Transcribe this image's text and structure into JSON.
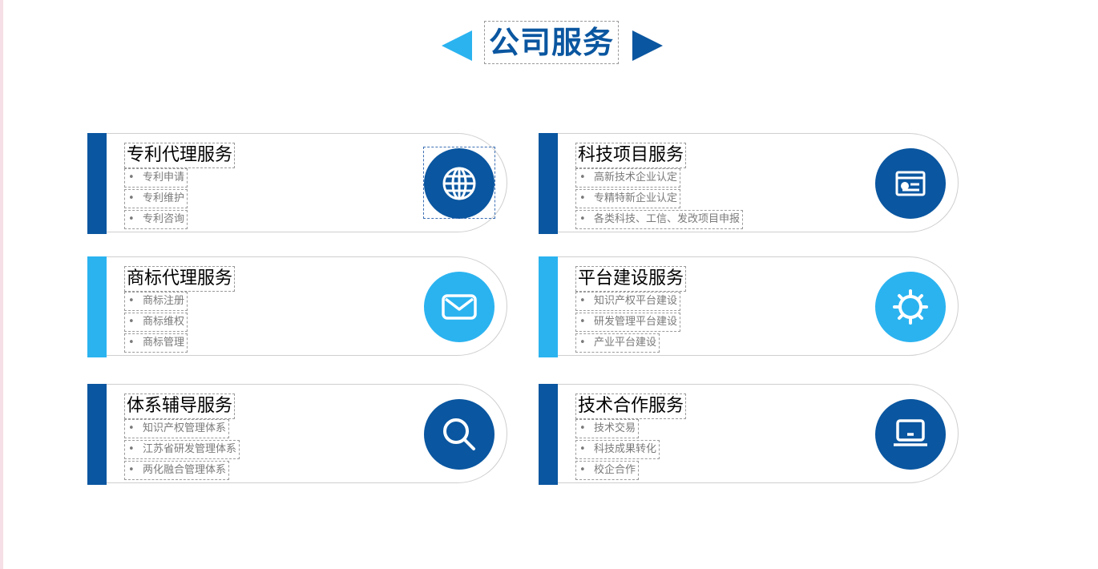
{
  "page": {
    "title": "公司服务",
    "colors": {
      "dark_blue": "#0a56a0",
      "light_blue": "#2bb3f0",
      "border_gray": "#cfcfcf"
    }
  },
  "services": [
    {
      "title": "专利代理服务",
      "items": [
        "专利申请",
        "专利维护",
        "专利咨询"
      ],
      "icon": "globe-icon",
      "theme": "dark"
    },
    {
      "title": "科技项目服务",
      "items": [
        "高新技术企业认定",
        "专精特新企业认定",
        "各类科技、工信、发改项目申报"
      ],
      "icon": "id-card-icon",
      "theme": "dark"
    },
    {
      "title": "商标代理服务",
      "items": [
        "商标注册",
        "商标维权",
        "商标管理"
      ],
      "icon": "mail-icon",
      "theme": "light"
    },
    {
      "title": "平台建设服务",
      "items": [
        "知识产权平台建设",
        "研发管理平台建设",
        "产业平台建设"
      ],
      "icon": "gear-icon",
      "theme": "light"
    },
    {
      "title": "体系辅导服务",
      "items": [
        "知识产权管理体系",
        "江苏省研发管理体系",
        "两化融合管理体系"
      ],
      "icon": "search-icon",
      "theme": "dark"
    },
    {
      "title": "技术合作服务",
      "items": [
        "技术交易",
        "科技成果转化",
        "校企合作"
      ],
      "icon": "laptop-icon",
      "theme": "dark"
    }
  ]
}
